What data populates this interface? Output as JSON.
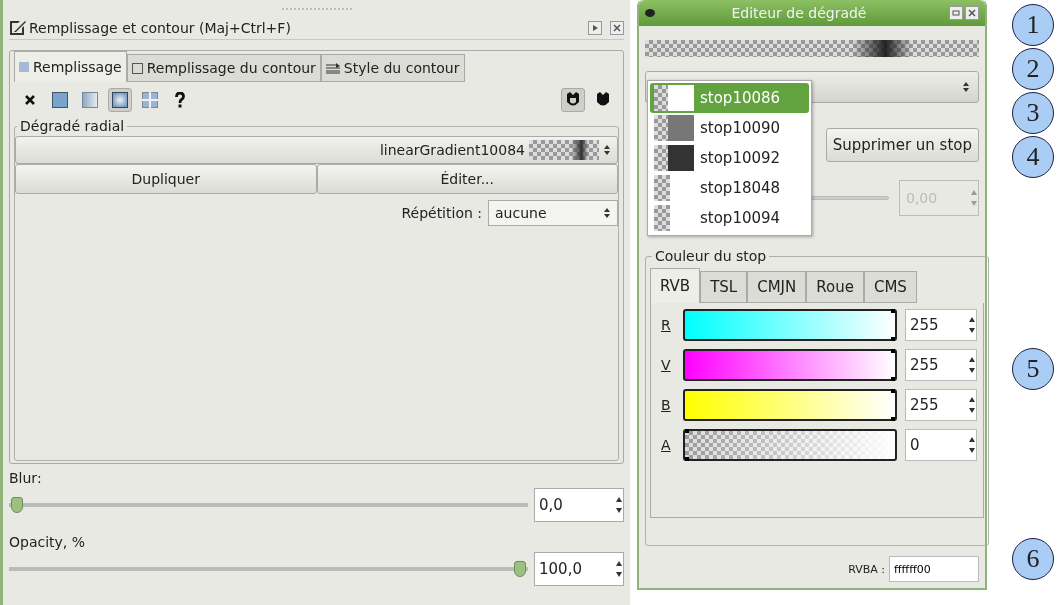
{
  "fill_stroke_panel": {
    "title": "Remplissage et contour (Maj+Ctrl+F)",
    "tabs": [
      {
        "label": "Remplissage",
        "selected": true,
        "kind": "fill"
      },
      {
        "label": "Remplissage du contour",
        "selected": false,
        "kind": "stroke"
      },
      {
        "label": "Style du contour",
        "selected": false,
        "kind": "style"
      }
    ],
    "paint_types": [
      {
        "kind": "none",
        "selected": false
      },
      {
        "kind": "flat",
        "selected": false
      },
      {
        "kind": "linear",
        "selected": false
      },
      {
        "kind": "radial",
        "selected": true
      },
      {
        "kind": "pattern",
        "selected": false
      },
      {
        "kind": "unset",
        "selected": false
      }
    ],
    "fill_rules": [
      {
        "kind": "evenodd",
        "selected": true
      },
      {
        "kind": "nonzero",
        "selected": false
      }
    ],
    "gradient_frame": {
      "title": "Dégradé radial",
      "gradient": "linearGradient10084",
      "buttons": [
        "Dupliquer",
        "Éditer..."
      ],
      "repeat_label": "Répétition :",
      "repeat_value": "aucune"
    },
    "blur": {
      "label": "Blur:",
      "level": 0,
      "value": "0,0"
    },
    "opacity": {
      "label": "Opacity, %",
      "level": 1,
      "value": "100,0"
    }
  },
  "gradient_editor": {
    "title": "Editeur de dégradé",
    "stops": [
      {
        "label": "stop10086",
        "kind": "solid",
        "color": "#ffffff",
        "selected": true
      },
      {
        "label": "stop10090",
        "kind": "solid",
        "color": "#777777",
        "selected": false
      },
      {
        "label": "stop10092",
        "kind": "solid",
        "color": "#333333",
        "selected": false
      },
      {
        "label": "stop18048",
        "kind": "clear",
        "selected": false
      },
      {
        "label": "stop10094",
        "kind": "clear",
        "selected": false
      }
    ],
    "delete_button": "Supprimer un stop",
    "offset_value": "0,00",
    "color_frame_title": "Couleur du stop",
    "tabs": [
      {
        "label": "RVB",
        "selected": true
      },
      {
        "label": "TSL",
        "selected": false
      },
      {
        "label": "CMJN",
        "selected": false
      },
      {
        "label": "Roue",
        "selected": false
      },
      {
        "label": "CMS",
        "selected": false
      }
    ],
    "channels": [
      {
        "label": "R",
        "kind": "red",
        "level": 1,
        "value": "255"
      },
      {
        "label": "V",
        "kind": "green",
        "level": 1,
        "value": "255"
      },
      {
        "label": "B",
        "kind": "blue",
        "level": 1,
        "value": "255"
      },
      {
        "label": "A",
        "kind": "alpha",
        "level": 0,
        "value": "0"
      }
    ],
    "rgba_label": "RVBA :",
    "rgba_value": "ffffff00"
  },
  "callouts": [
    "1",
    "2",
    "3",
    "4",
    "5",
    "6"
  ]
}
